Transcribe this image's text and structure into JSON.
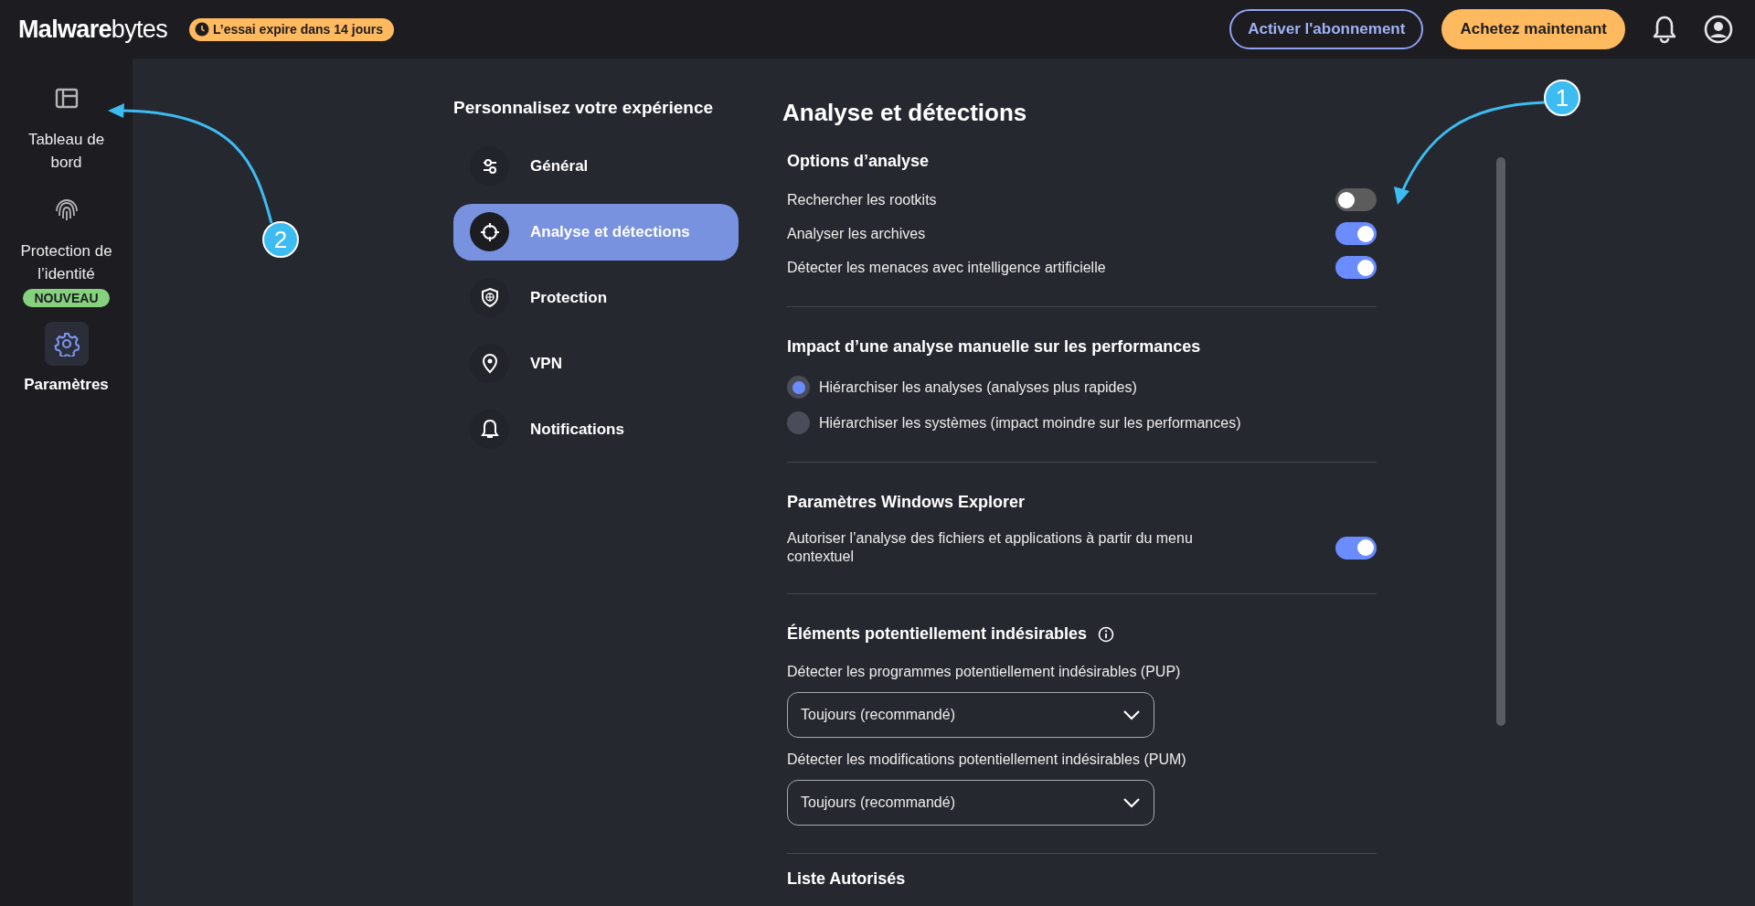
{
  "header": {
    "logo": "**Malware**bytes",
    "trial_badge": "L’essai expire dans 14 jours",
    "buttons": [
      {
        "label": "Activer l'abonnement",
        "kind": "outline"
      },
      {
        "label": "Achetez maintenant",
        "kind": "primary"
      }
    ]
  },
  "sidebar": {
    "items": [
      {
        "label": "Tableau de bord",
        "selected": false
      },
      {
        "label": "Protection de l’identité",
        "selected": false,
        "badge": "NOUVEAU"
      },
      {
        "label": "Paramètres",
        "selected": true
      }
    ]
  },
  "settings_nav": {
    "title": "Personnalisez votre expérience",
    "items": [
      {
        "label": "Général",
        "selected": false
      },
      {
        "label": "Analyse et détections",
        "selected": true
      },
      {
        "label": "Protection",
        "selected": false
      },
      {
        "label": "VPN",
        "selected": false
      },
      {
        "label": "Notifications",
        "selected": false
      }
    ]
  },
  "content": {
    "title": "Analyse et détections",
    "sections": [
      {
        "title": "Options d’analyse",
        "info": false,
        "rows": [
          {
            "kind": "toggle",
            "label": "Rechercher les rootkits",
            "on": false
          },
          {
            "kind": "toggle",
            "label": "Analyser les archives",
            "on": true
          },
          {
            "kind": "toggle",
            "label": "Détecter les menaces avec intelligence artificielle",
            "on": true
          }
        ]
      },
      {
        "title": "Impact d’une analyse manuelle sur les performances",
        "info": false,
        "rows": [
          {
            "kind": "radio",
            "label": "Hiérarchiser les analyses (analyses plus rapides)",
            "selected": true
          },
          {
            "kind": "radio",
            "label": "Hiérarchiser les systèmes (impact moindre sur les performances)",
            "selected": false
          }
        ]
      },
      {
        "title": "Paramètres Windows Explorer",
        "info": false,
        "rows": [
          {
            "kind": "toggle",
            "label": "Autoriser l’analyse des fichiers et applications à partir du menu contextuel",
            "on": true
          }
        ]
      },
      {
        "title": "Éléments potentiellement indésirables",
        "info": true,
        "rows": [
          {
            "kind": "select",
            "label": "Détecter les programmes potentiellement indésirables (PUP)",
            "value": "Toujours (recommandé)"
          },
          {
            "kind": "select",
            "label": "Détecter les modifications potentiellement indésirables (PUM)",
            "value": "Toujours (recommandé)"
          }
        ]
      },
      {
        "title": "Liste Autorisés",
        "info": false
      }
    ]
  },
  "annotations": [
    {
      "number": "1"
    },
    {
      "number": "2"
    }
  ]
}
